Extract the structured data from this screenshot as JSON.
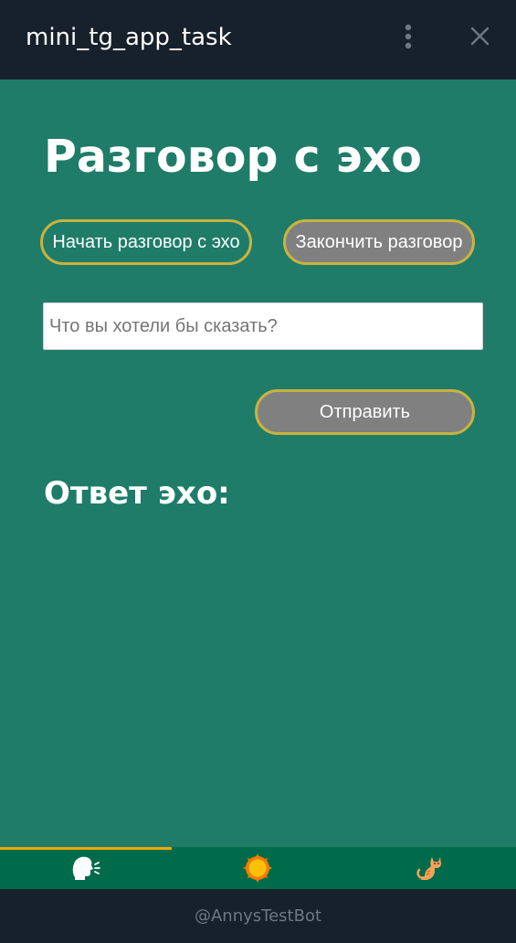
{
  "window": {
    "title": "mini_tg_app_task",
    "menu_icon": "more-vertical-icon",
    "close_icon": "close-icon"
  },
  "page": {
    "heading": "Разговор с эхо",
    "start_button": "Начать разговор с эхо",
    "end_button": "Закончить разговор",
    "input": {
      "placeholder": "Что вы хотели бы сказать?",
      "value": ""
    },
    "send_button": "Отправить",
    "reply_heading": "Ответ эхо:",
    "reply_text": ""
  },
  "bottom_nav": {
    "tabs": [
      {
        "icon": "speaking-head-icon",
        "active": true
      },
      {
        "icon": "sun-icon",
        "active": false
      },
      {
        "icon": "cat-icon",
        "active": false
      }
    ]
  },
  "footer": {
    "bot_handle": "@AnnysTestBot"
  },
  "colors": {
    "header_bg": "#17212b",
    "page_bg": "#1f7c69",
    "nav_bg": "#006b4b",
    "button_border": "#c9b23e",
    "button_gray": "#808080",
    "active_tab_indicator": "#f0a800",
    "footer_text": "#6c7883"
  }
}
